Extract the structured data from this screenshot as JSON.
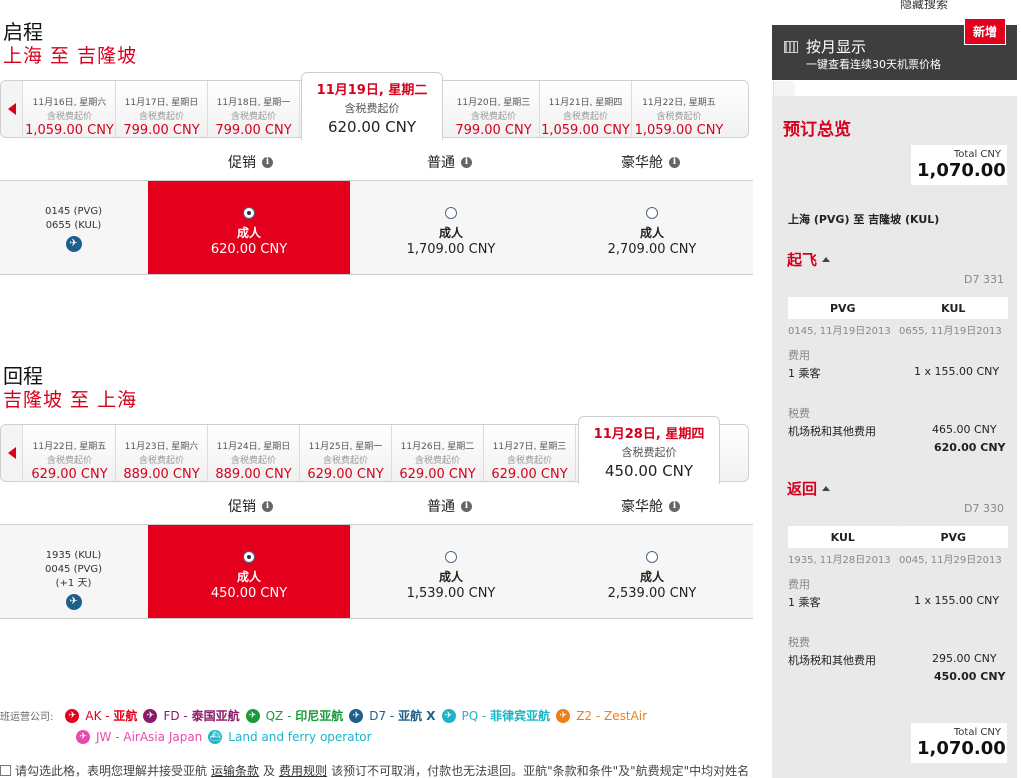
{
  "outbound": {
    "section_label": "启程",
    "route": "上海 至 吉隆坡",
    "dates": [
      {
        "date": "11月16日, 星期六",
        "sub": "含税费起价",
        "price": "1,059.00 CNY"
      },
      {
        "date": "11月17日, 星期日",
        "sub": "含税费起价",
        "price": "799.00 CNY"
      },
      {
        "date": "11月18日, 星期一",
        "sub": "含税费起价",
        "price": "799.00 CNY"
      },
      {
        "date": "11月19日, 星期二",
        "sub": "含税费起价",
        "price": "620.00 CNY",
        "selected": true
      },
      {
        "date": "11月20日, 星期三",
        "sub": "含税费起价",
        "price": "799.00 CNY"
      },
      {
        "date": "11月21日, 星期四",
        "sub": "含税费起价",
        "price": "1,059.00 CNY"
      },
      {
        "date": "11月22日, 星期五",
        "sub": "含税费起价",
        "price": "1,059.00 CNY"
      }
    ],
    "fare_headers": [
      "促销",
      "普通",
      "豪华舱"
    ],
    "flight": {
      "line1": "0145 (PVG)",
      "line2": "0655 (KUL)",
      "line3": ""
    },
    "fares": [
      {
        "label": "成人",
        "amount": "620.00 CNY",
        "selected": true
      },
      {
        "label": "成人",
        "amount": "1,709.00 CNY"
      },
      {
        "label": "成人",
        "amount": "2,709.00 CNY"
      }
    ]
  },
  "return": {
    "section_label": "回程",
    "route": "吉隆坡 至 上海",
    "dates": [
      {
        "date": "11月22日, 星期五",
        "sub": "含税费起价",
        "price": "629.00 CNY"
      },
      {
        "date": "11月23日, 星期六",
        "sub": "含税费起价",
        "price": "889.00 CNY"
      },
      {
        "date": "11月24日, 星期日",
        "sub": "含税费起价",
        "price": "889.00 CNY"
      },
      {
        "date": "11月25日, 星期一",
        "sub": "含税费起价",
        "price": "629.00 CNY"
      },
      {
        "date": "11月26日, 星期二",
        "sub": "含税费起价",
        "price": "629.00 CNY"
      },
      {
        "date": "11月27日, 星期三",
        "sub": "含税费起价",
        "price": "629.00 CNY"
      },
      {
        "date": "11月28日, 星期四",
        "sub": "含税费起价",
        "price": "450.00 CNY",
        "selected": true
      }
    ],
    "fare_headers": [
      "促销",
      "普通",
      "豪华舱"
    ],
    "flight": {
      "line1": "1935 (KUL)",
      "line2": "0045 (PVG)",
      "line3": "(+1 天)"
    },
    "fares": [
      {
        "label": "成人",
        "amount": "450.00 CNY",
        "selected": true
      },
      {
        "label": "成人",
        "amount": "1,539.00 CNY"
      },
      {
        "label": "成人",
        "amount": "2,539.00 CNY"
      }
    ]
  },
  "carriers": {
    "label": "航班运营公司:",
    "items": [
      {
        "code": "AK",
        "name": "亚航",
        "color": "#e4001c"
      },
      {
        "code": "FD",
        "name": "泰国亚航",
        "color": "#8b1a6b"
      },
      {
        "code": "QZ",
        "name": "印尼亚航",
        "color": "#1a9a3a"
      },
      {
        "code": "D7",
        "name": "亚航 X",
        "color": "#1f5f8b"
      },
      {
        "code": "PQ",
        "name": "菲律宾亚航",
        "color": "#1ab6c8"
      },
      {
        "code": "Z2",
        "name": "ZestAir",
        "color": "#f07f1a"
      },
      {
        "code": "JW",
        "name": "AirAsia Japan",
        "color": "#e84ab0"
      },
      {
        "code": "",
        "name": "Land and ferry operator",
        "color": "#1ab6c8"
      }
    ]
  },
  "bottom_note": {
    "prefix": "请勾选此格，表明您理解并接受亚航",
    "link1": "运输条款",
    "mid": "及",
    "link2": "费用规则",
    "suffix": "该预订不可取消，付款也无法退回。亚航\"条款和条件\"及\"航费规定\"中均对姓名"
  },
  "sidebar": {
    "hide_search": "隐藏搜索",
    "month_view": {
      "title": "按月显示",
      "subtitle": "一键查看连续30天机票价格",
      "badge": "新增"
    },
    "summary_title": "预订总览",
    "total_label": "Total CNY",
    "total_value": "1,070.00",
    "route_text": "上海 (PVG) 至 吉隆坡 (KUL)",
    "depart": {
      "heading": "起飞",
      "flight_no": "D7 331",
      "from": "PVG",
      "to": "KUL",
      "from_time": "0145, 11月19日2013",
      "to_time": "0655, 11月19日2013",
      "fee_label": "费用",
      "pax": "1 乘客",
      "pax_price": "1 x 155.00 CNY",
      "tax_label": "税费",
      "tax_name": "机场税和其他费用",
      "tax_value": "465.00 CNY",
      "subtotal": "620.00 CNY"
    },
    "return": {
      "heading": "返回",
      "flight_no": "D7 330",
      "from": "KUL",
      "to": "PVG",
      "from_time": "1935, 11月28日2013",
      "to_time": "0045, 11月29日2013",
      "fee_label": "费用",
      "pax": "1 乘客",
      "pax_price": "1 x 155.00 CNY",
      "tax_label": "税费",
      "tax_name": "机场税和其他费用",
      "tax_value": "295.00 CNY",
      "subtotal": "450.00 CNY"
    },
    "bottom_total_label": "Total CNY",
    "bottom_total_value": "1,070.00"
  }
}
